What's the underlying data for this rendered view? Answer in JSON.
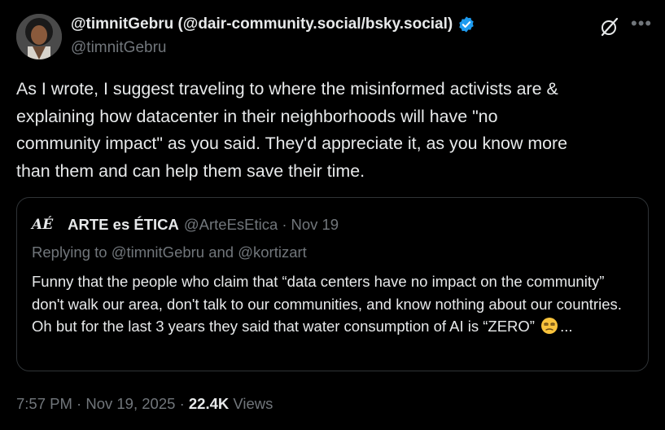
{
  "author": {
    "display_name": "@timnitGebru (@dair-community.social/bsky.social)",
    "handle": "@timnitGebru"
  },
  "tweet": {
    "text": "As I wrote, I suggest traveling to where the misinformed activists are &\nexplaining how datacenter in their neighborhoods will have \"no\ncommunity impact\" as you said. They'd appreciate it, as you know more\nthan them and can help them save their time."
  },
  "quoted_tweet": {
    "logo_text": "AÉ",
    "display_name": "ARTE es ÉTICA",
    "handle": "@ArteEsEtica",
    "separator": "·",
    "date": "Nov 19",
    "replying_to": "Replying to @timnitGebru and @kortizart",
    "text_before_emoji": "Funny that the people who claim that “data centers have no impact on the community” don't walk our area, don't talk to our communities, and know nothing about our countries. Oh but for the last 3 years they said that water consumption of AI is “ZERO”",
    "text_after_emoji": "...",
    "emoji": "unamused-face-emoji"
  },
  "footer": {
    "time": "7:57 PM",
    "sep1": "·",
    "date": "Nov 19, 2025",
    "sep2": "·",
    "views_count": "22.4K",
    "views_label": "Views"
  },
  "icons": {
    "verified": "verified-badge-icon",
    "grok": "grok-icon",
    "more": "more-options-icon"
  },
  "colors": {
    "background": "#000000",
    "text_primary": "#e7e9ea",
    "text_secondary": "#71767b",
    "border": "#2f3336",
    "verified": "#1d9bf0"
  }
}
